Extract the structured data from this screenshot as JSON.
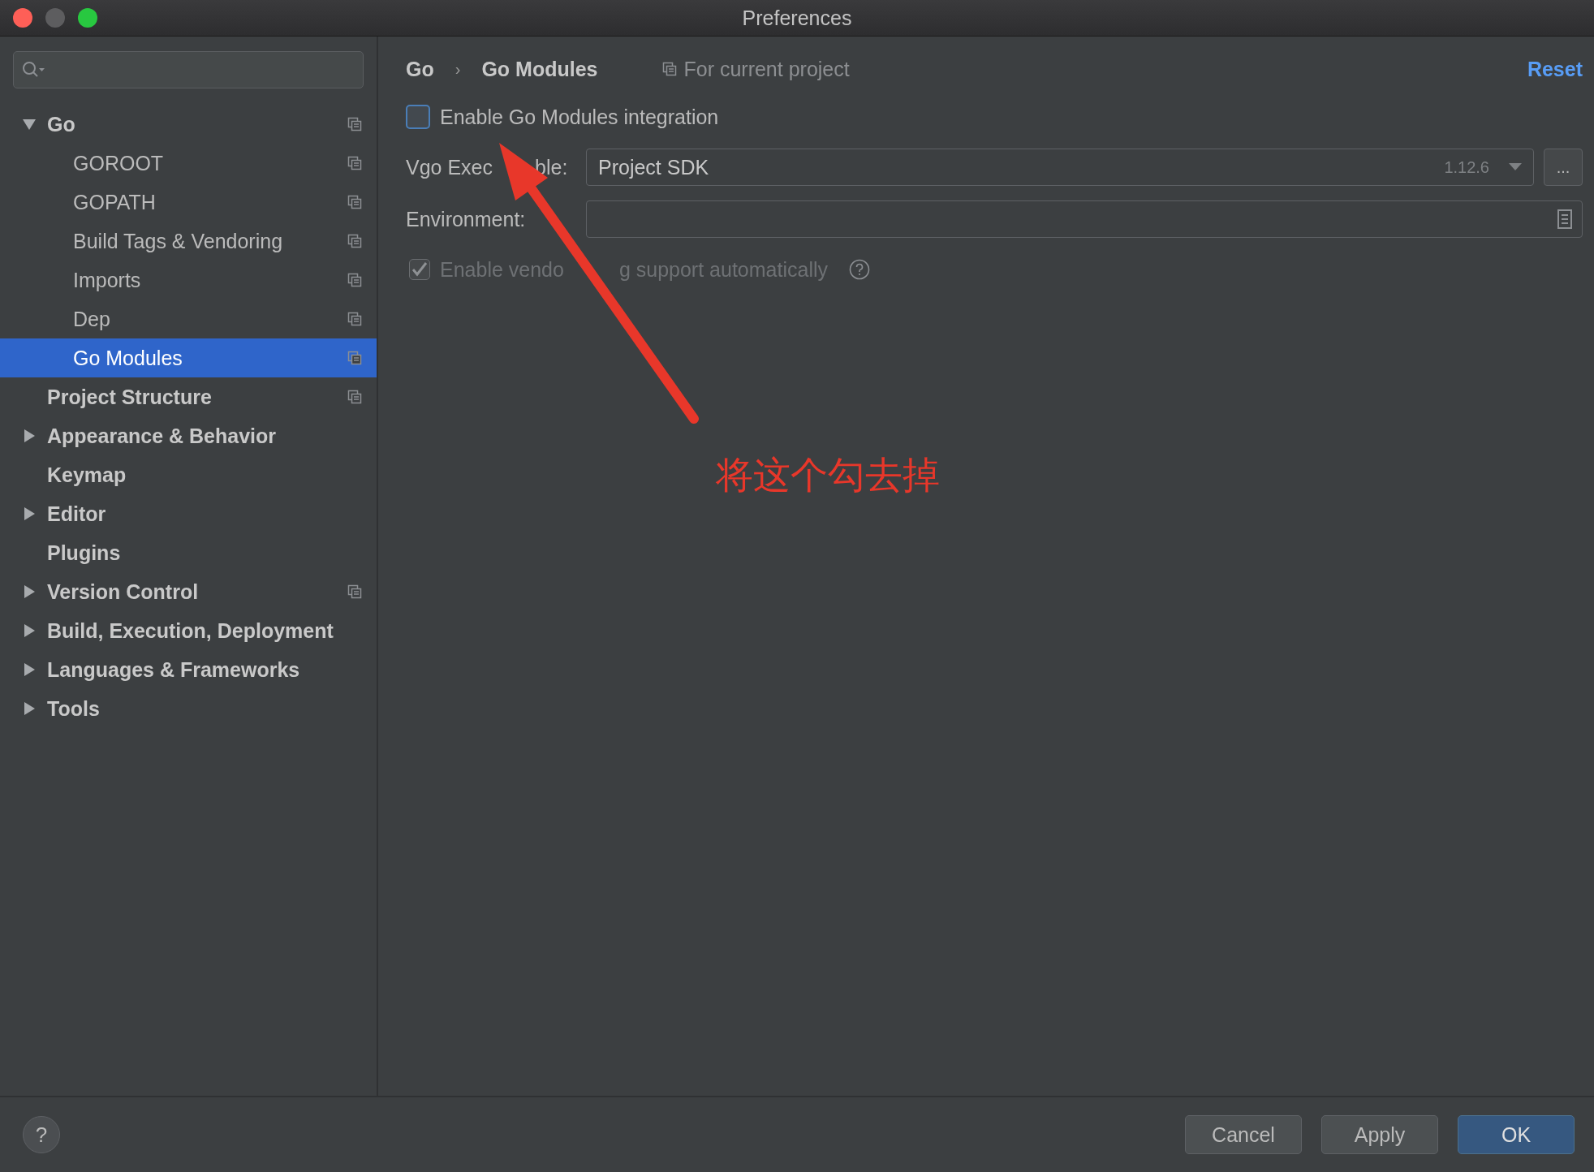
{
  "window": {
    "title": "Preferences"
  },
  "sidebar": {
    "items": [
      {
        "label": "Go",
        "kind": "group",
        "expanded": true,
        "selected": false,
        "project_scoped": true,
        "children": [
          {
            "label": "GOROOT",
            "selected": false,
            "project_scoped": true
          },
          {
            "label": "GOPATH",
            "selected": false,
            "project_scoped": true
          },
          {
            "label": "Build Tags & Vendoring",
            "selected": false,
            "project_scoped": true
          },
          {
            "label": "Imports",
            "selected": false,
            "project_scoped": true
          },
          {
            "label": "Dep",
            "selected": false,
            "project_scoped": true
          },
          {
            "label": "Go Modules",
            "selected": true,
            "project_scoped": true
          }
        ]
      },
      {
        "label": "Project Structure",
        "kind": "leaf",
        "selected": false,
        "project_scoped": true
      },
      {
        "label": "Appearance & Behavior",
        "kind": "group",
        "expanded": false,
        "selected": false,
        "project_scoped": false
      },
      {
        "label": "Keymap",
        "kind": "leaf",
        "selected": false,
        "project_scoped": false
      },
      {
        "label": "Editor",
        "kind": "group",
        "expanded": false,
        "selected": false,
        "project_scoped": false
      },
      {
        "label": "Plugins",
        "kind": "leaf",
        "selected": false,
        "project_scoped": false
      },
      {
        "label": "Version Control",
        "kind": "group",
        "expanded": false,
        "selected": false,
        "project_scoped": true
      },
      {
        "label": "Build, Execution, Deployment",
        "kind": "group",
        "expanded": false,
        "selected": false,
        "project_scoped": false
      },
      {
        "label": "Languages & Frameworks",
        "kind": "group",
        "expanded": false,
        "selected": false,
        "project_scoped": false
      },
      {
        "label": "Tools",
        "kind": "group",
        "expanded": false,
        "selected": false,
        "project_scoped": false
      }
    ]
  },
  "content": {
    "breadcrumb": [
      "Go",
      "Go Modules"
    ],
    "breadcrumb_separator": "›",
    "scope": "For current project",
    "reset": "Reset",
    "enable_modules": {
      "label": "Enable Go Modules integration",
      "checked": false
    },
    "vgo_executable": {
      "label_parts": [
        "Vgo Exec",
        "ble:"
      ],
      "value": "Project SDK",
      "version": "1.12.6",
      "browse": "..."
    },
    "environment": {
      "label": "Environment:"
    },
    "vendoring": {
      "label_parts": [
        "Enable vendo",
        "g support automatically"
      ],
      "checked": true,
      "disabled": true
    },
    "annotation": {
      "text": "将这个勾去掉"
    }
  },
  "help_button": "?",
  "buttons": [
    {
      "label": "Cancel",
      "default": false
    },
    {
      "label": "Apply",
      "default": false
    },
    {
      "label": "OK",
      "default": true
    }
  ]
}
